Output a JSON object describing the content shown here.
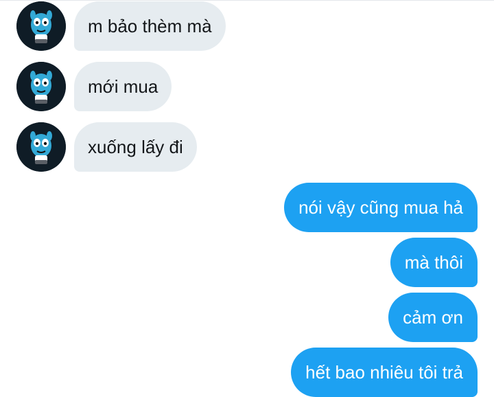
{
  "conversation": {
    "messages": [
      {
        "direction": "incoming",
        "text": "m bảo thèm mà",
        "avatar_icon": "gumball-avatar-icon"
      },
      {
        "direction": "incoming",
        "text": "mới mua",
        "avatar_icon": "gumball-avatar-icon"
      },
      {
        "direction": "incoming",
        "text": "xuống lấy đi",
        "avatar_icon": "gumball-avatar-icon"
      },
      {
        "direction": "outgoing",
        "text": "nói vậy cũng mua hả"
      },
      {
        "direction": "outgoing",
        "text": "mà thôi"
      },
      {
        "direction": "outgoing",
        "text": "cảm ơn"
      },
      {
        "direction": "outgoing",
        "text": "hết bao nhiêu tôi trả"
      }
    ]
  },
  "colors": {
    "incoming_bubble": "#e6ecf0",
    "incoming_text": "#14171a",
    "outgoing_bubble": "#1da1f2",
    "outgoing_text": "#ffffff",
    "avatar_background": "#0f1c26",
    "avatar_character": "#33a9d6"
  }
}
